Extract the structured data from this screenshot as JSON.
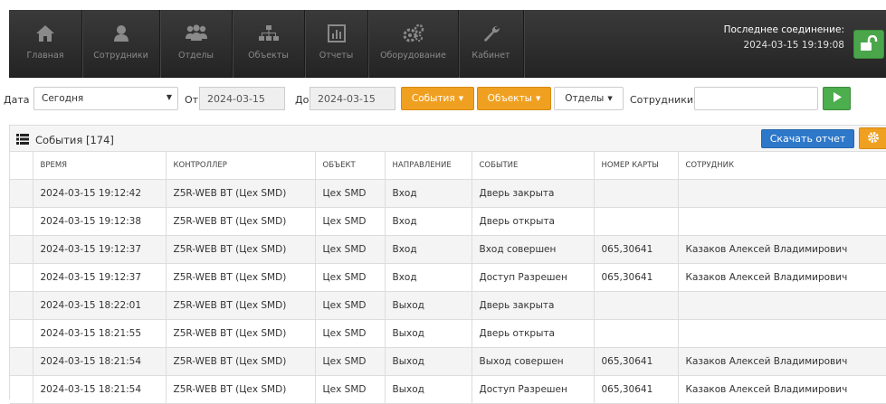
{
  "nav": {
    "items": [
      {
        "label": "Главная",
        "icon": "home-icon"
      },
      {
        "label": "Сотрудники",
        "icon": "user-icon"
      },
      {
        "label": "Отделы",
        "icon": "users-icon"
      },
      {
        "label": "Объекты",
        "icon": "sitemap-icon"
      },
      {
        "label": "Отчеты",
        "icon": "chart-icon"
      },
      {
        "label": "Оборудование",
        "icon": "gears-icon"
      },
      {
        "label": "Кабинет",
        "icon": "wrench-icon"
      }
    ],
    "connection_label": "Последнее соединение:",
    "connection_value": "2024-03-15 19:19:08"
  },
  "filters": {
    "date_label": "Дата",
    "date_selected": "Сегодня",
    "from_label": "От",
    "from_value": "2024-03-15",
    "to_label": "До",
    "to_value": "2024-03-15",
    "events_button": "События",
    "objects_button": "Объекты",
    "departments_button": "Отделы",
    "employees_label": "Сотрудники",
    "employees_value": ""
  },
  "panel": {
    "title": "События [174]",
    "download_button": "Скачать отчет"
  },
  "table": {
    "headers": [
      "ВРЕМЯ",
      "КОНТРОЛЛЕР",
      "ОБЪЕКТ",
      "НАПРАВЛЕНИЕ",
      "СОБЫТИЕ",
      "НОМЕР КАРТЫ",
      "СОТРУДНИК"
    ],
    "rows": [
      [
        "2024-03-15 19:12:42",
        "Z5R-WEB BT (Цех SMD)",
        "Цех SMD",
        "Вход",
        "Дверь закрыта",
        "",
        ""
      ],
      [
        "2024-03-15 19:12:38",
        "Z5R-WEB BT (Цех SMD)",
        "Цех SMD",
        "Вход",
        "Дверь открыта",
        "",
        ""
      ],
      [
        "2024-03-15 19:12:37",
        "Z5R-WEB BT (Цех SMD)",
        "Цех SMD",
        "Вход",
        "Вход совершен",
        "065,30641",
        "Казаков Алексей Владимирович"
      ],
      [
        "2024-03-15 19:12:37",
        "Z5R-WEB BT (Цех SMD)",
        "Цех SMD",
        "Вход",
        "Доступ Разрешен",
        "065,30641",
        "Казаков Алексей Владимирович"
      ],
      [
        "2024-03-15 18:22:01",
        "Z5R-WEB BT (Цех SMD)",
        "Цех SMD",
        "Выход",
        "Дверь закрыта",
        "",
        ""
      ],
      [
        "2024-03-15 18:21:55",
        "Z5R-WEB BT (Цех SMD)",
        "Цех SMD",
        "Выход",
        "Дверь открыта",
        "",
        ""
      ],
      [
        "2024-03-15 18:21:54",
        "Z5R-WEB BT (Цех SMD)",
        "Цех SMD",
        "Выход",
        "Выход совершен",
        "065,30641",
        "Казаков Алексей Владимирович"
      ],
      [
        "2024-03-15 18:21:54",
        "Z5R-WEB BT (Цех SMD)",
        "Цех SMD",
        "Выход",
        "Доступ Разрешен",
        "065,30641",
        "Казаков Алексей Владимирович"
      ]
    ]
  },
  "colors": {
    "navbar": "#2e2e2e",
    "orange": "#f0a020",
    "blue": "#2e78c9",
    "green": "#4cae4c"
  }
}
